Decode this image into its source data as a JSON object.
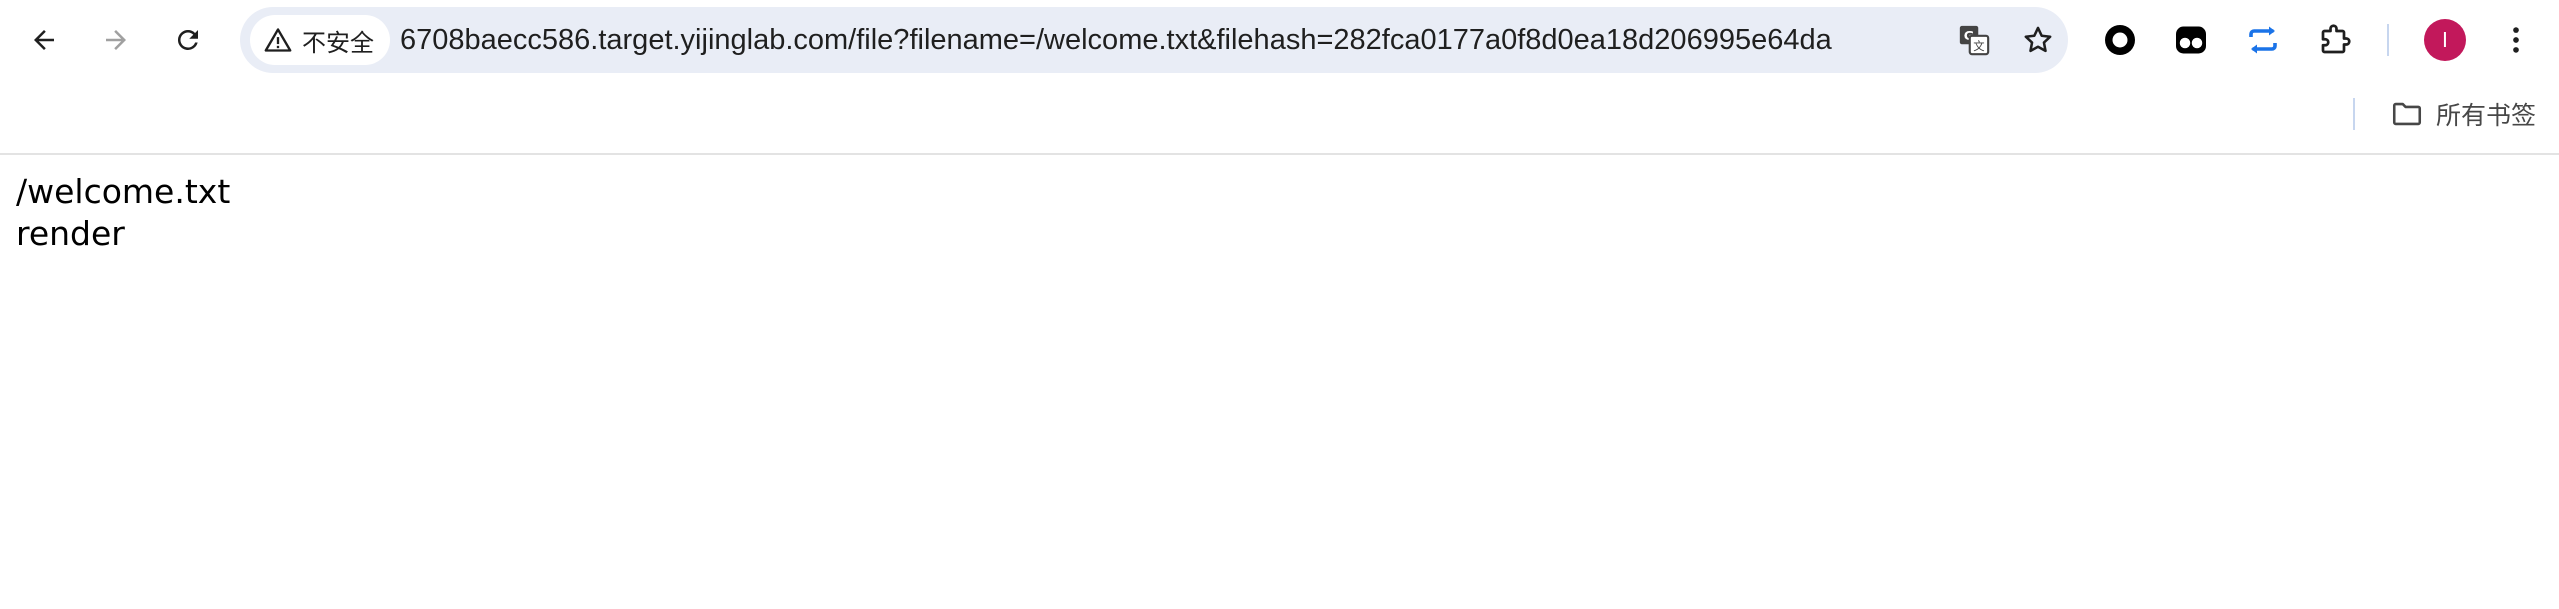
{
  "toolbar": {
    "back_icon": "arrow-left-icon",
    "forward_icon": "arrow-right-icon",
    "reload_icon": "reload-icon"
  },
  "omnibox": {
    "security_label": "不安全",
    "url": "6708baecc586.target.yijinglab.com/file?filename=/welcome.txt&filehash=282fca0177a0f8d0ea18d206995e64da",
    "translate_icon": "translate-icon",
    "bookmark_icon": "star-icon"
  },
  "extensions": {
    "items": [
      "circle-extension-icon",
      "dual-toggle-extension-icon",
      "sync-arrows-extension-icon",
      "puzzle-extensions-icon"
    ]
  },
  "profile": {
    "avatar_letter": "I",
    "avatar_color": "#c2185b"
  },
  "bookmarks_bar": {
    "all_bookmarks_label": "所有书签"
  },
  "page": {
    "lines": [
      "/welcome.txt",
      "render"
    ]
  }
}
